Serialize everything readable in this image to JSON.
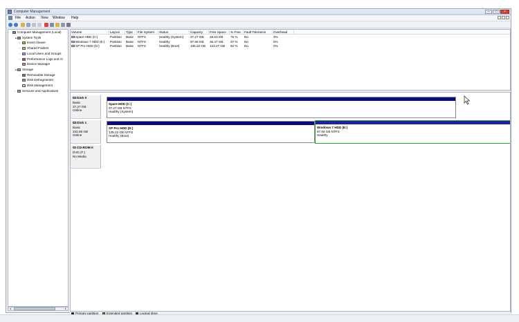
{
  "window": {
    "title": "Computer Management"
  },
  "menu": [
    "File",
    "Action",
    "View",
    "Window",
    "Help"
  ],
  "toolbar_icons": [
    "back-icon",
    "forward-icon",
    "up-icon",
    "properties-icon",
    "help-icon",
    "console-icon",
    "delete-icon",
    "settings-icon",
    "folder-icon",
    "drive-icon",
    "disk-icon"
  ],
  "tree": [
    {
      "label": "Computer Management (Local)",
      "depth": 0,
      "exp": ""
    },
    {
      "label": "System Tools",
      "depth": 1,
      "exp": "▲"
    },
    {
      "label": "Event Viewer",
      "depth": 2,
      "exp": "›"
    },
    {
      "label": "Shared Folders",
      "depth": 2,
      "exp": "›"
    },
    {
      "label": "Local Users and Groups",
      "depth": 2,
      "exp": "›"
    },
    {
      "label": "Performance Logs and Al",
      "depth": 2,
      "exp": "›"
    },
    {
      "label": "Device Manager",
      "depth": 2,
      "exp": ""
    },
    {
      "label": "Storage",
      "depth": 1,
      "exp": "▲"
    },
    {
      "label": "Removable Storage",
      "depth": 2,
      "exp": "›"
    },
    {
      "label": "Disk Defragmenter",
      "depth": 2,
      "exp": ""
    },
    {
      "label": "Disk Management",
      "depth": 2,
      "exp": ""
    },
    {
      "label": "Services and Applications",
      "depth": 1,
      "exp": "›"
    }
  ],
  "volume_columns": [
    "Volume",
    "Layout",
    "Type",
    "File System",
    "Status",
    "Capacity",
    "Free Space",
    "% Free",
    "Fault Tolerance",
    "Overhead"
  ],
  "volumes": [
    [
      "Spare HDD (C:)",
      "Partition",
      "Basic",
      "NTFS",
      "Healthy (System)",
      "37.27 GB",
      "28.63 GB",
      "75 %",
      "No",
      "0%"
    ],
    [
      "Windows 7 HDD (E:)",
      "Partition",
      "Basic",
      "NTFS",
      "Healthy",
      "97.66 GB",
      "36.47 GB",
      "37 %",
      "No",
      "0%"
    ],
    [
      "XP Pro HDD (D:)",
      "Partition",
      "Basic",
      "NTFS",
      "Healthy (Boot)",
      "135.22 GB",
      "123.27 GB",
      "92 %",
      "No",
      "0%"
    ]
  ],
  "disks": [
    {
      "name": "Disk 0",
      "type": "Basic",
      "size": "37.27 GB",
      "state": "Online"
    },
    {
      "name": "Disk 1",
      "type": "Basic",
      "size": "232.88 GB",
      "state": "Online"
    },
    {
      "name": "CD-ROM 0",
      "type": "DVD (F:)",
      "size": "",
      "state": "No Media"
    }
  ],
  "partitions": [
    {
      "name": "Spare HDD (C:)",
      "size": "37.27 GB NTFS",
      "status": "Healthy (System)"
    },
    {
      "name": "XP Pro HDD (D:)",
      "size": "135.22 GB NTFS",
      "status": "Healthy (Boot)"
    },
    {
      "name": "Windows 7 HDD (E:)",
      "size": "97.66 GB NTFS",
      "status": "Healthy"
    }
  ],
  "legend": [
    {
      "label": "Primary partition",
      "color": "#0a0a7a"
    },
    {
      "label": "Extended partition",
      "color": "#2aa02a"
    },
    {
      "label": "Logical drive",
      "color": "#2020d0"
    }
  ]
}
